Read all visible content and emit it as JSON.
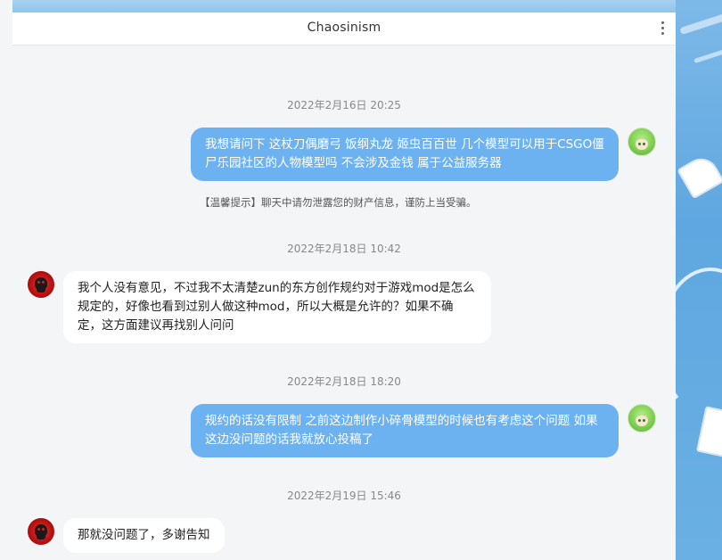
{
  "window": {
    "title": "Chaosinism",
    "menu_icon": "more-vertical-icon"
  },
  "notice": "【温馨提示】聊天中请勿泄露您的财产信息，谨防上当受骗。",
  "messages": [
    {
      "timestamp": "2022年2月16日 20:25",
      "sender": "me",
      "avatar": "green-hair-avatar",
      "text": "我想请问下 这杖刀偶磨弓 饭纲丸龙 姬虫百百世 几个模型可以用于CSGO僵尸乐园社区的人物模型吗 不会涉及金钱 属于公益服务器"
    },
    {
      "timestamp": "2022年2月18日 10:42",
      "sender": "them",
      "avatar": "red-skull-avatar",
      "text": "我个人没有意见，不过我不太清楚zun的东方创作规约对于游戏mod是怎么规定的，好像也看到过别人做这种mod，所以大概是允许的？如果不确定，这方面建议再找别人问问"
    },
    {
      "timestamp": "2022年2月18日 18:20",
      "sender": "me",
      "avatar": "green-hair-avatar",
      "text": "规约的话没有限制 之前这边制作小碎骨模型的时候也有考虑这个问题 如果这边没问题的话我就放心投稿了"
    },
    {
      "timestamp": "2022年2月19日 15:46",
      "sender": "them",
      "avatar": "red-skull-avatar",
      "text": "那就没问题了，多谢告知"
    }
  ]
}
